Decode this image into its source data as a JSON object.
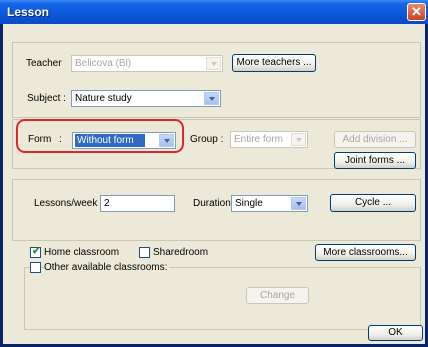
{
  "window": {
    "title": "Lesson",
    "close_label": "✕"
  },
  "teacher": {
    "label": "Teacher",
    "value": "Belicova (Bl)",
    "more_button": "More teachers ..."
  },
  "subject": {
    "label": "Subject :",
    "value": "Nature study"
  },
  "form": {
    "label": "Form",
    "colon": ":",
    "value": "Without form",
    "group_label": "Group :",
    "group_value": "Entire form",
    "add_division_button": "Add division ...",
    "joint_forms_button": "Joint forms ..."
  },
  "lessons": {
    "label": "Lessons/week :",
    "value": "2",
    "duration_label": "Duration",
    "duration_value": "Single",
    "cycle_button": "Cycle ..."
  },
  "classrooms": {
    "home_label": "Home classroom",
    "home_checked": true,
    "shared_label": "Sharedroom",
    "shared_checked": false,
    "more_button": "More classrooms...",
    "other_label": "Other available classrooms:",
    "other_checked": false,
    "change_button": "Change"
  },
  "ok_button": "OK",
  "colors": {
    "titlebar": "#0b57d8",
    "highlight": "#e0262a",
    "dialog": "#ece9d8"
  }
}
